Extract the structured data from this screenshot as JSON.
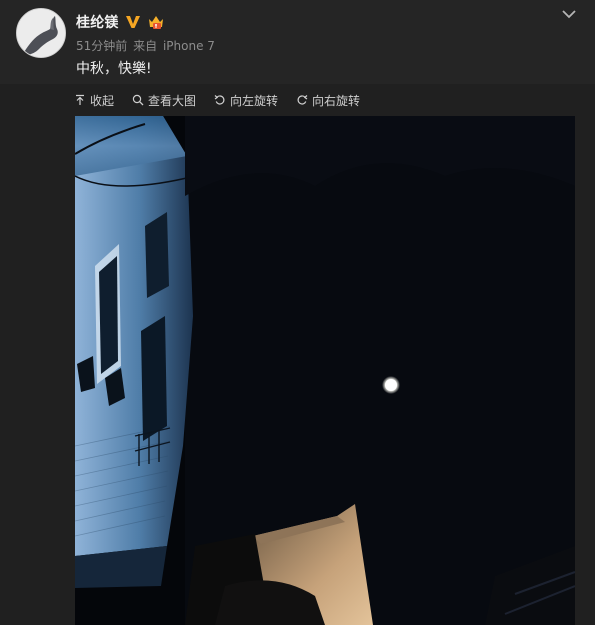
{
  "post": {
    "author": "桂纶镁",
    "time": "51分钟前",
    "source_prefix": "来自",
    "source": "iPhone 7",
    "text": "中秋，快樂!"
  },
  "icons": {
    "verified": "verified-v-icon",
    "member": "member-crown-icon",
    "menu": "chevron-down-icon",
    "collapse": "collapse-up-icon",
    "view": "magnifier-icon",
    "rotate_left": "rotate-left-icon",
    "rotate_right": "rotate-right-icon"
  },
  "toolbar": {
    "collapse_label": "收起",
    "view_large_label": "查看大图",
    "rotate_left_label": "向左旋转",
    "rotate_right_label": "向右旋转"
  },
  "colors": {
    "background": "#202020",
    "verified_gold": "#f5a623",
    "member_orange": "#f7b12a"
  }
}
